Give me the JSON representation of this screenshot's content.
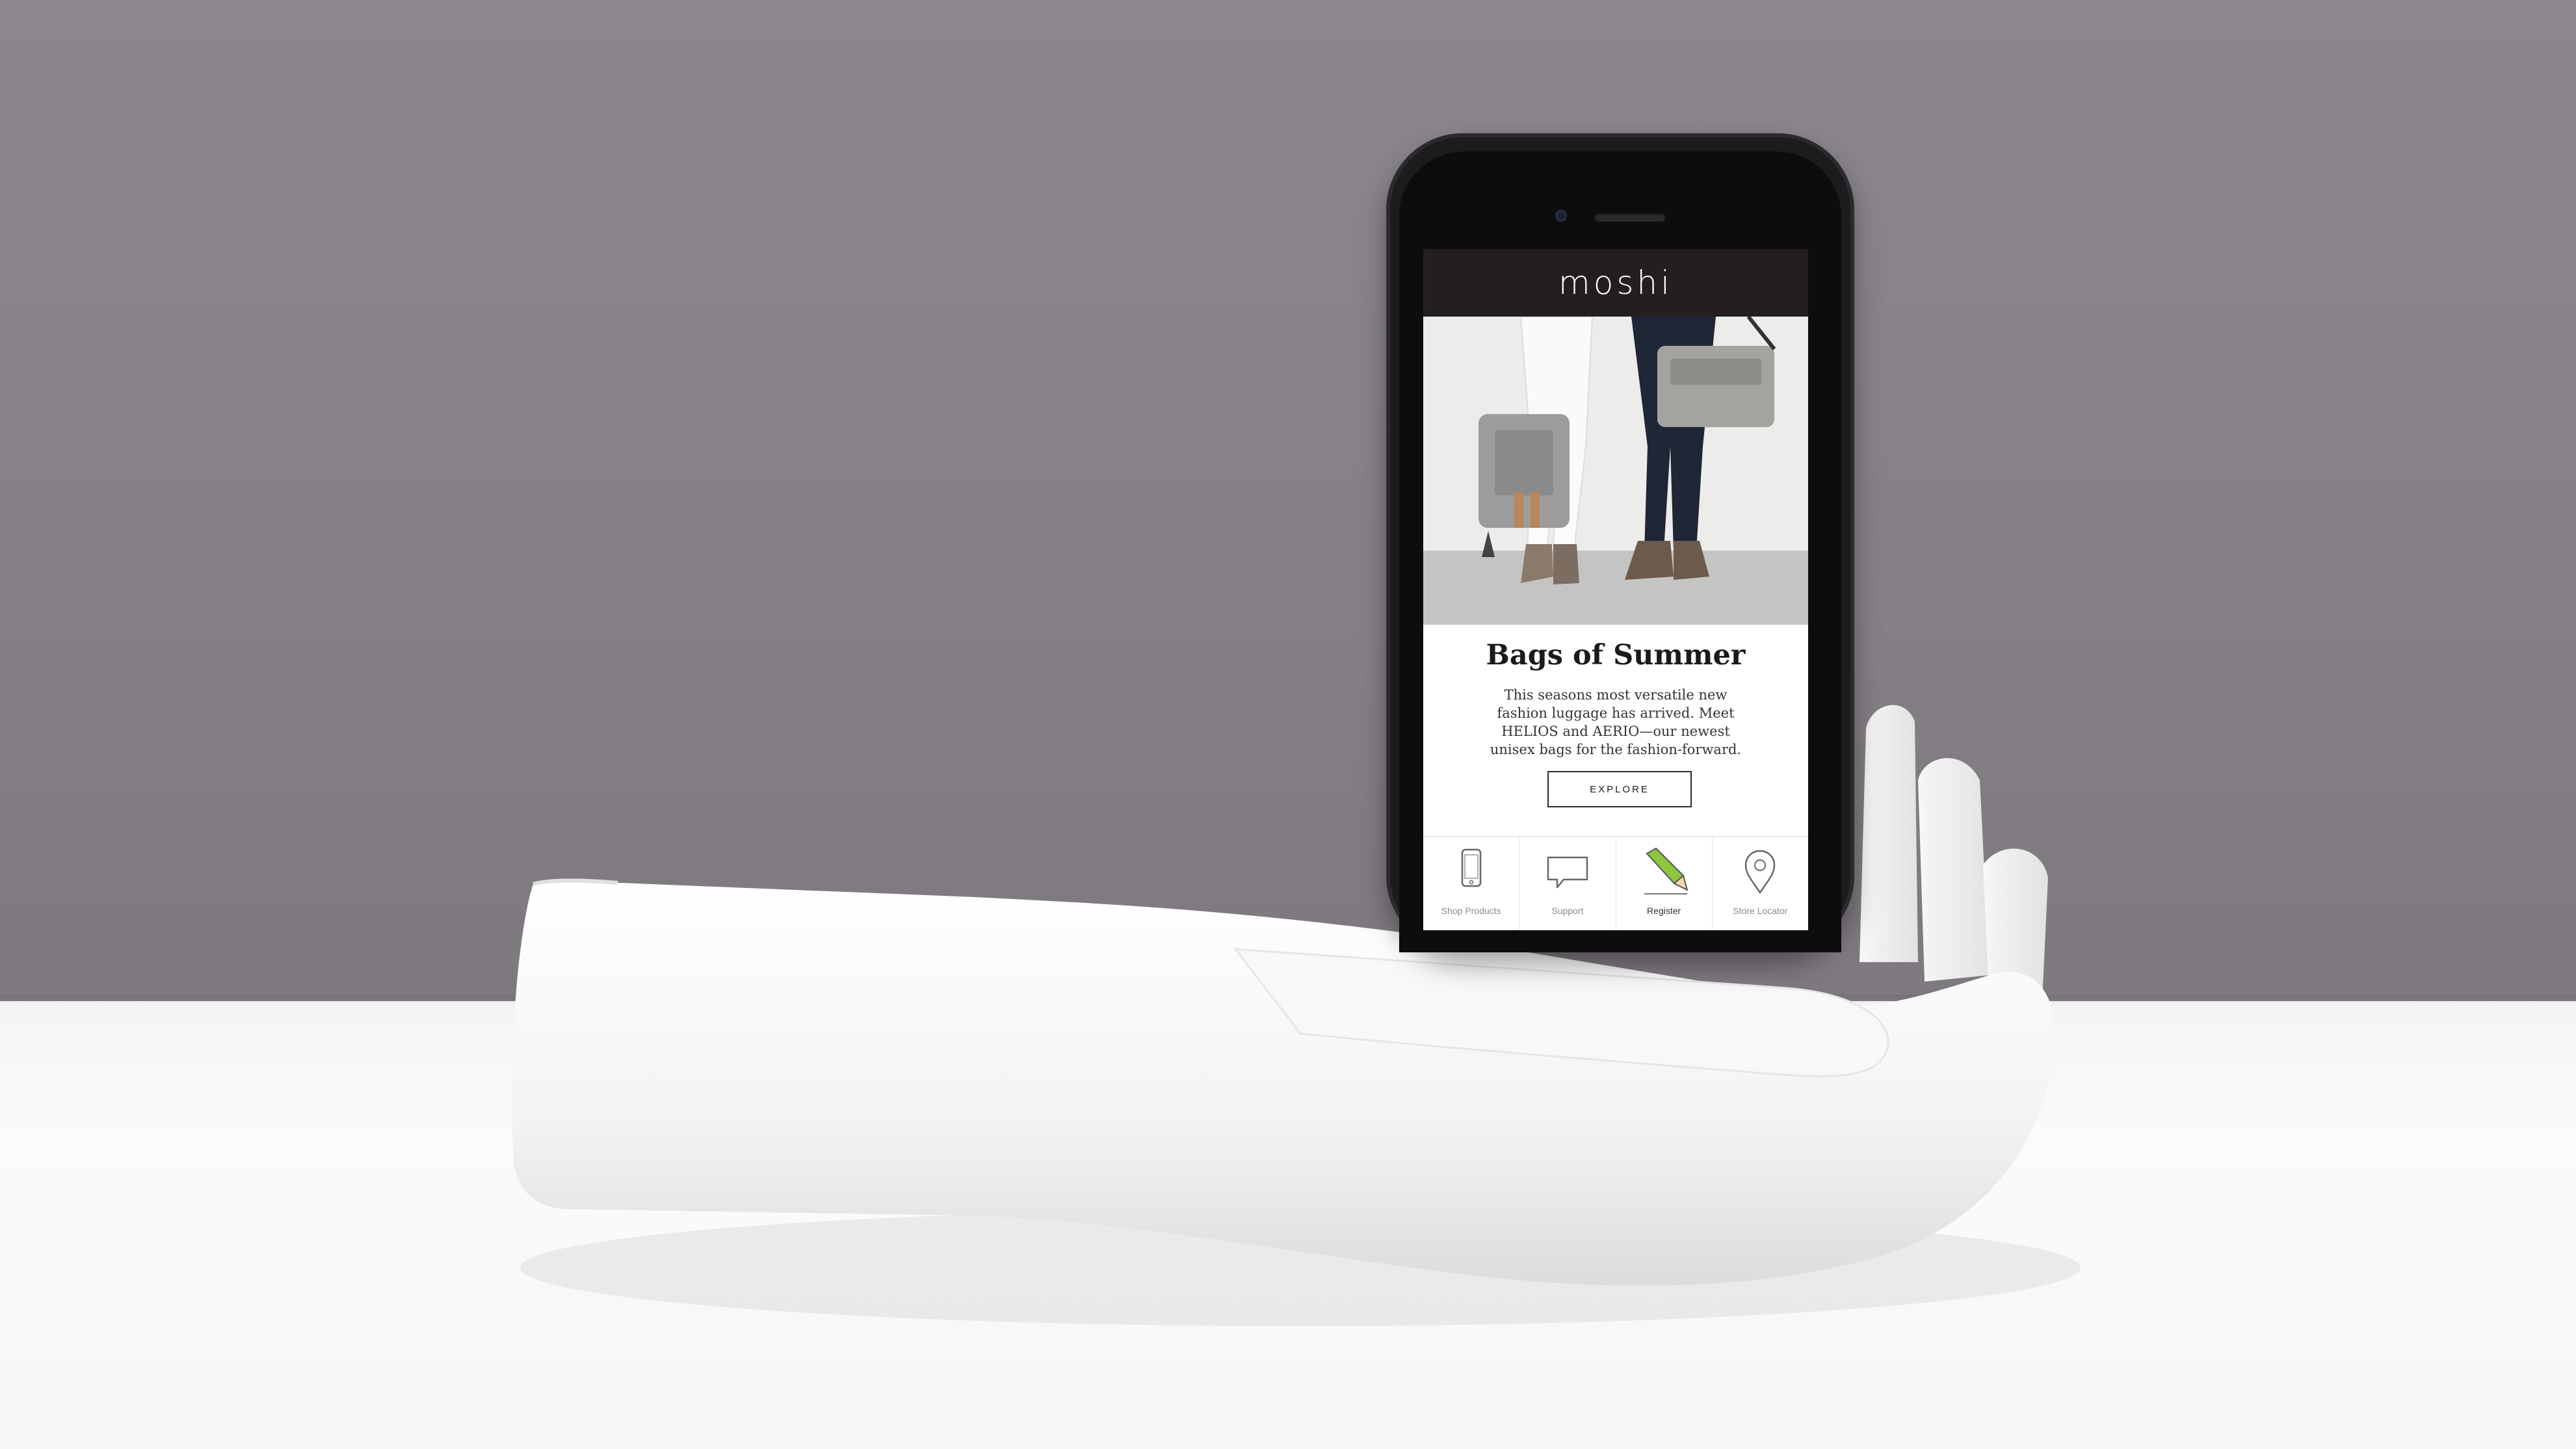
{
  "app": {
    "logo": "moshi"
  },
  "promo": {
    "headline": "Bags of Summer",
    "body_line1": "This seasons most versatile new",
    "body_line2": "fashion luggage has arrived. Meet",
    "body_line3": "HELIOS and AERIO—our newest",
    "body_line4": "unisex bags for the fashion-forward.",
    "cta_label": "EXPLORE"
  },
  "tabbar": {
    "items": [
      {
        "label": "Shop Products",
        "icon": "phone-icon"
      },
      {
        "label": "Support",
        "icon": "speech-bubble-icon"
      },
      {
        "label": "Register",
        "icon": "pencil-icon"
      },
      {
        "label": "Store Locator",
        "icon": "map-pin-icon"
      }
    ],
    "active_index": 2
  },
  "colors": {
    "header_bg": "#231f20",
    "register_accent": "#8dc63f",
    "backdrop": "#858086"
  }
}
